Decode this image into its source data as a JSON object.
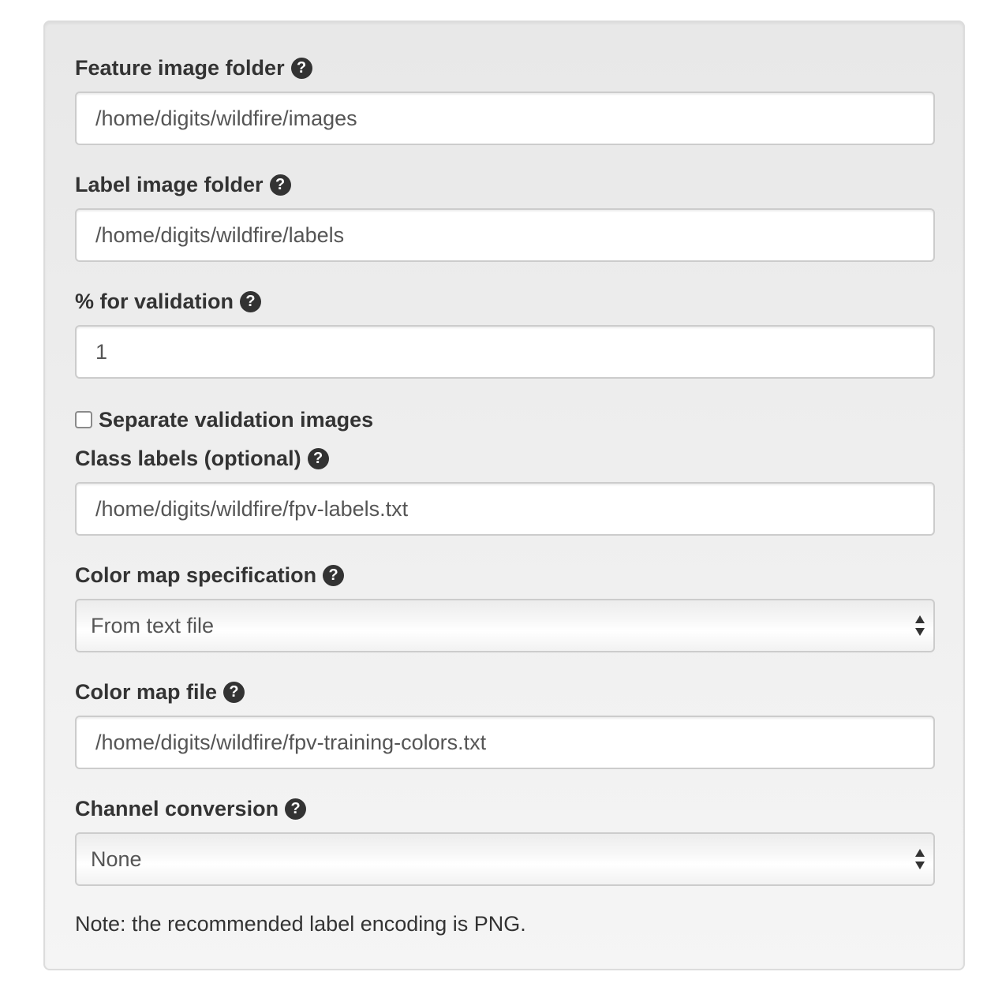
{
  "form": {
    "feature_folder": {
      "label": "Feature image folder",
      "value": "/home/digits/wildfire/images",
      "help_icon": "question-circle-icon"
    },
    "label_folder": {
      "label": "Label image folder",
      "value": "/home/digits/wildfire/labels",
      "help_icon": "question-circle-icon"
    },
    "validation_pct": {
      "label": "% for validation",
      "value": "1",
      "help_icon": "question-circle-icon"
    },
    "separate_validation": {
      "label": "Separate validation images",
      "checked": false
    },
    "class_labels": {
      "label": "Class labels (optional)",
      "value": "/home/digits/wildfire/fpv-labels.txt",
      "help_icon": "question-circle-icon"
    },
    "color_map_spec": {
      "label": "Color map specification",
      "selected": "From text file",
      "help_icon": "question-circle-icon"
    },
    "color_map_file": {
      "label": "Color map file",
      "value": "/home/digits/wildfire/fpv-training-colors.txt",
      "help_icon": "question-circle-icon"
    },
    "channel_conversion": {
      "label": "Channel conversion",
      "selected": "None",
      "help_icon": "question-circle-icon"
    },
    "note": "Note: the recommended label encoding is PNG."
  },
  "help_icon_glyph": "?",
  "colors": {
    "panel_background": "#f5f5f5",
    "text": "#333333",
    "input_border": "#cccccc"
  }
}
